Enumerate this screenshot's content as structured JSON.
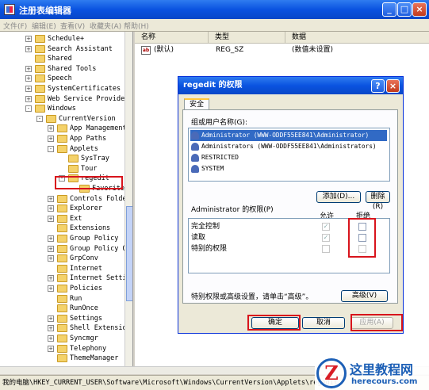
{
  "window": {
    "title": "注册表编辑器",
    "menu": [
      "文件(F)",
      "编辑(E)",
      "查看(V)",
      "收藏夹(A)",
      "帮助(H)"
    ]
  },
  "tree": {
    "items": [
      {
        "label": "Schedule+",
        "exp": "+"
      },
      {
        "label": "Search Assistant",
        "exp": "+"
      },
      {
        "label": "Shared",
        "exp": ""
      },
      {
        "label": "Shared Tools",
        "exp": "+"
      },
      {
        "label": "Speech",
        "exp": "+"
      },
      {
        "label": "SystemCertificates",
        "exp": "+"
      },
      {
        "label": "Web Service Providers",
        "exp": "+"
      },
      {
        "label": "Windows",
        "exp": "-"
      },
      {
        "label": "CurrentVersion",
        "exp": "-"
      },
      {
        "label": "App Management",
        "exp": "+"
      },
      {
        "label": "App Paths",
        "exp": "+"
      },
      {
        "label": "Applets",
        "exp": "-"
      },
      {
        "label": "SysTray",
        "exp": ""
      },
      {
        "label": "Tour",
        "exp": ""
      },
      {
        "label": "regedit",
        "exp": "-"
      },
      {
        "label": "Favorites",
        "exp": ""
      },
      {
        "label": "Controls Folder",
        "exp": "+"
      },
      {
        "label": "Explorer",
        "exp": "+"
      },
      {
        "label": "Ext",
        "exp": "+"
      },
      {
        "label": "Extensions",
        "exp": ""
      },
      {
        "label": "Group Policy",
        "exp": "+"
      },
      {
        "label": "Group Policy O",
        "exp": "+"
      },
      {
        "label": "GrpConv",
        "exp": "+"
      },
      {
        "label": "Internet",
        "exp": ""
      },
      {
        "label": "Internet Setti",
        "exp": "+"
      },
      {
        "label": "Policies",
        "exp": "+"
      },
      {
        "label": "Run",
        "exp": ""
      },
      {
        "label": "RunOnce",
        "exp": ""
      },
      {
        "label": "Settings",
        "exp": "+"
      },
      {
        "label": "Shell Extension",
        "exp": "+"
      },
      {
        "label": "Syncmgr",
        "exp": "+"
      },
      {
        "label": "Telephony",
        "exp": "+"
      },
      {
        "label": "ThemeManager",
        "exp": ""
      }
    ]
  },
  "list": {
    "columns": [
      "名称",
      "类型",
      "数据"
    ],
    "rows": [
      {
        "name": "(默认)",
        "type": "REG_SZ",
        "data": "(数值未设置)"
      }
    ],
    "icon_text": "ab"
  },
  "status_text": "我的电脑\\HKEY_CURRENT_USER\\Software\\Microsoft\\Windows\\CurrentVersion\\Applets\\regedit",
  "dialog": {
    "title": "regedit 的权限",
    "help": "?",
    "close": "×",
    "tab": "安全",
    "group_label": "组或用户名称(G):",
    "users": [
      "Administrator (WWW-ODDF55EE841\\Administrator)",
      "Administrators (WWW-ODDF55EE841\\Administrators)",
      "RESTRICTED",
      "SYSTEM"
    ],
    "add_button": "添加(D)...",
    "remove_button": "删除(R)",
    "perm_label": "Administrator 的权限(P)",
    "allow_header": "允许",
    "deny_header": "拒绝",
    "permissions": [
      {
        "name": "完全控制",
        "allow": true,
        "deny": false
      },
      {
        "name": "读取",
        "allow": true,
        "deny": false
      },
      {
        "name": "特别的权限",
        "allow": false,
        "deny": false
      }
    ],
    "advanced_text": "特别权限或高级设置，请单击“高级”。",
    "advanced_button": "高级(V)",
    "ok": "确定",
    "cancel": "取消",
    "apply": "应用(A)"
  },
  "watermark": {
    "logo_letter": "Z",
    "site_name": "这里教程网",
    "site_url": "herecours.com"
  }
}
